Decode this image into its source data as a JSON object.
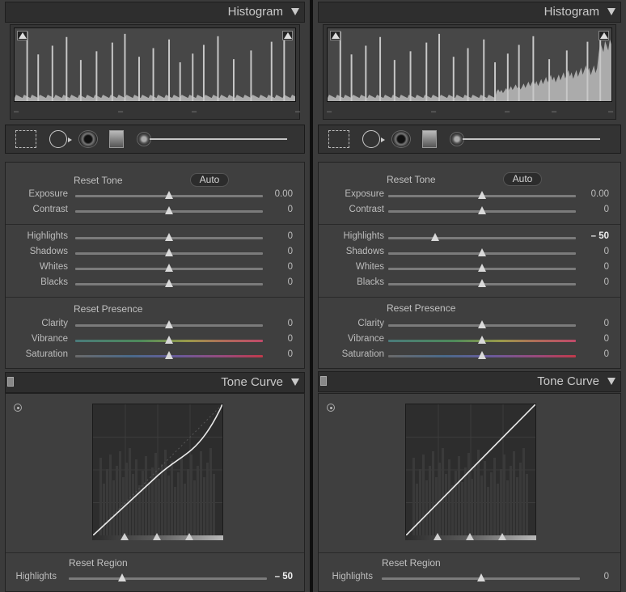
{
  "left": {
    "histogram": {
      "title": "Histogram",
      "dashes": [
        "–",
        "–",
        "–",
        "–"
      ]
    },
    "basic": {
      "reset_tone": "Reset Tone",
      "auto": "Auto",
      "tone": [
        {
          "label": "Exposure",
          "value": "0.00",
          "pos": 0.5
        },
        {
          "label": "Contrast",
          "value": "0",
          "pos": 0.5
        }
      ],
      "tone2": [
        {
          "label": "Highlights",
          "value": "0",
          "pos": 0.5
        },
        {
          "label": "Shadows",
          "value": "0",
          "pos": 0.5
        },
        {
          "label": "Whites",
          "value": "0",
          "pos": 0.5
        },
        {
          "label": "Blacks",
          "value": "0",
          "pos": 0.5
        }
      ],
      "reset_presence": "Reset Presence",
      "presence": [
        {
          "label": "Clarity",
          "value": "0",
          "pos": 0.5
        },
        {
          "label": "Vibrance",
          "value": "0",
          "pos": 0.5
        },
        {
          "label": "Saturation",
          "value": "0",
          "pos": 0.5
        }
      ]
    },
    "tone_curve": {
      "title": "Tone Curve",
      "reset_region": "Reset Region",
      "highlights": {
        "label": "Highlights",
        "value": "– 50",
        "pos": 0.27
      }
    }
  },
  "right": {
    "histogram": {
      "title": "Histogram",
      "dashes": [
        "–",
        "–",
        "–",
        "–",
        "–"
      ]
    },
    "basic": {
      "reset_tone": "Reset Tone",
      "auto": "Auto",
      "tone": [
        {
          "label": "Exposure",
          "value": "0.00",
          "pos": 0.5
        },
        {
          "label": "Contrast",
          "value": "0",
          "pos": 0.5
        }
      ],
      "tone2": [
        {
          "label": "Highlights",
          "value": "– 50",
          "pos": 0.25
        },
        {
          "label": "Shadows",
          "value": "0",
          "pos": 0.5
        },
        {
          "label": "Whites",
          "value": "0",
          "pos": 0.5
        },
        {
          "label": "Blacks",
          "value": "0",
          "pos": 0.5
        }
      ],
      "reset_presence": "Reset Presence",
      "presence": [
        {
          "label": "Clarity",
          "value": "0",
          "pos": 0.5
        },
        {
          "label": "Vibrance",
          "value": "0",
          "pos": 0.5
        },
        {
          "label": "Saturation",
          "value": "0",
          "pos": 0.5
        }
      ]
    },
    "tone_curve": {
      "title": "Tone Curve",
      "reset_region": "Reset Region",
      "highlights": {
        "label": "Highlights",
        "value": "0",
        "pos": 0.5
      }
    }
  },
  "colors": {
    "panel_bg": "#3b3b3b",
    "slider_thumb": "#d9d9d9",
    "vibrance_track": "gradient teal-green-yellow-red",
    "saturation_track": "gradient blue-purple-red"
  }
}
